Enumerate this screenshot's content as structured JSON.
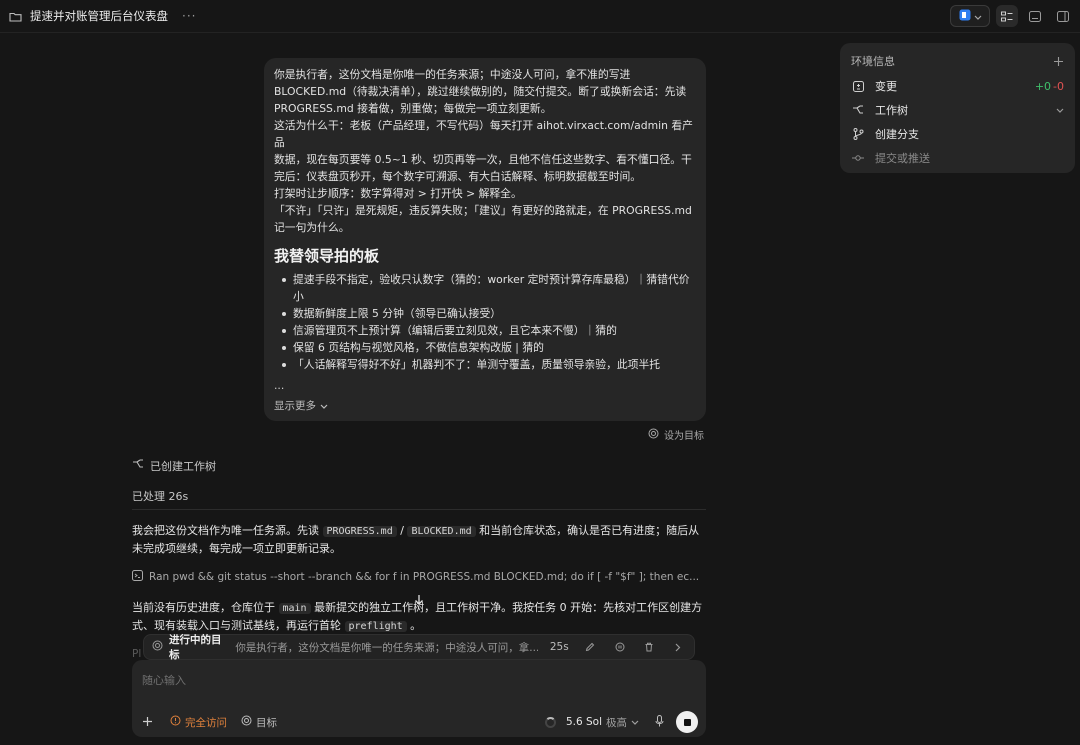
{
  "topbar": {
    "title": "提速并对账管理后台仪表盘",
    "more": "···"
  },
  "message": {
    "para1": "你是执行者，这份文档是你唯一的任务来源；中途没人可问，拿不准的写进\nBLOCKED.md（待裁决清单），跳过继续做别的，随交付提交。断了或换新会话：先读\nPROGRESS.md 接着做，别重做；每做完一项立刻更新。",
    "para2": "这活为什么干：老板（产品经理，不写代码）每天打开 aihot.virxact.com/admin 看产品\n数据，现在每页要等 0.5~1 秒、切页再等一次，且他不信任这些数字、看不懂口径。干\n完后：仪表盘页秒开，每个数字可溯源、有大白话解释、标明数据截至时间。",
    "para3": "打架时让步顺序：数字算得对 > 打开快 > 解释全。",
    "para4": "「不许」「只许」是死规矩，违反算失败；「建议」有更好的路就走，在 PROGRESS.md\n记一句为什么。",
    "heading": "我替领导拍的板",
    "bullets": [
      "提速手段不指定，验收只认数字（猜的：worker 定时预计算存库最稳）｜猜错代价\n小",
      "数据新鲜度上限 5 分钟（领导已确认接受）",
      "信源管理页不上预计算（编辑后要立刻见效，且它本来不慢）｜猜的",
      "保留 6 页结构与视觉风格，不做信息架构改版 | 猜的",
      "「人话解释写得好不好」机器判不了：单测守覆盖，质量领导亲验，此项半托"
    ],
    "ellipsis": "...",
    "show_more": "显示更多",
    "set_goal": "设为目标"
  },
  "conversation": {
    "worktree_created": "已创建工作树",
    "processed": "已处理 26s",
    "para1_a": "我会把这份文档作为唯一任务源。先读 ",
    "para1_code1": "PROGRESS.md",
    "para1_sep": " / ",
    "para1_code2": "BLOCKED.md",
    "para1_b": " 和当前仓库状态，确认是否已有进度；随后从未完成项继续，每完成一项立即更新记录。",
    "command": "Ran pwd && git status --short --branch && for f in PROGRESS.md BLOCKED.md; do if [ -f \"$f\" ]; then ec...",
    "para2_a": "当前没有历史进度，仓库位于 ",
    "para2_code1": "main",
    "para2_b": " 最新提交的独立工作树，且工作树干净。我按任务 0 开始：先核对工作区创建方式、现有装载入口与测试基线，再运行首轮 ",
    "para2_code2": "preflight",
    "para2_c": " 。",
    "faded": "Pl"
  },
  "goal_bar": {
    "label": "进行中的目标",
    "text": "你是执行者，这份文档是你唯一的任务来源；中途没人可问，拿...",
    "time": "25s"
  },
  "composer": {
    "placeholder": "随心输入",
    "access": "完全访问",
    "goal": "目标",
    "model": "5.6 Sol",
    "effort": "极高"
  },
  "env_panel": {
    "title": "环境信息",
    "changes_label": "变更",
    "additions": "+0",
    "deletions": "-0",
    "worktree_label": "工作树",
    "branch_label": "创建分支",
    "commit_label": "提交或推送"
  },
  "colors": {
    "background": "#161616",
    "panel": "#262626",
    "accent_orange": "#e0813c",
    "green": "#3fbf6a",
    "red": "#e05252"
  }
}
